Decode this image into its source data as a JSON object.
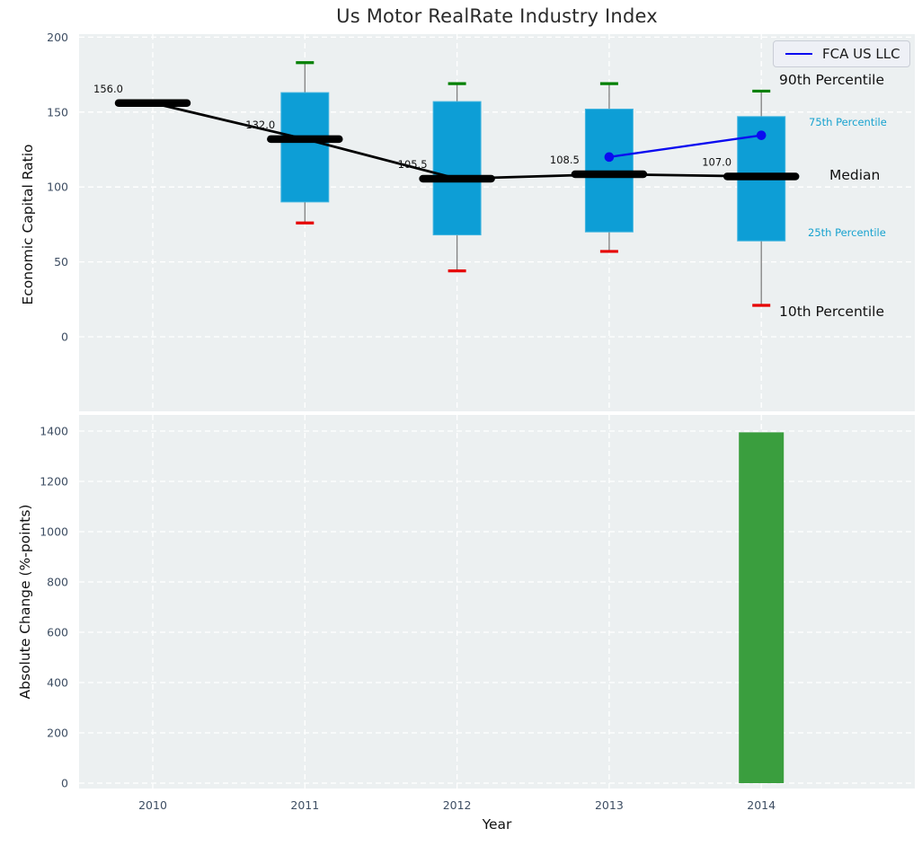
{
  "title": "Us Motor RealRate Industry Index",
  "axes": {
    "top_ylabel": "Economic Capital Ratio",
    "bottom_ylabel": "Absolute Change (%-points)",
    "xlabel": "Year"
  },
  "legend": {
    "label": "FCA US LLC"
  },
  "percentile_labels": {
    "p90": "90th Percentile",
    "p75": "75th Percentile",
    "median": "Median",
    "p25": "25th Percentile",
    "p10": "10th Percentile"
  },
  "colors": {
    "plot_bg": "#ecf0f1",
    "grid": "#ffffff",
    "tick_text": "#3e4e63",
    "box_fill": "#0d9ed6",
    "box_edge": "#45b6e0",
    "whisker_line": "#808080",
    "whisker_high_cap": "#008000",
    "whisker_low_cap": "#e60000",
    "median_line": "#000000",
    "company_line": "#0b0bf0",
    "bar_fill": "#3a9e3e",
    "median_label_text": "#111111"
  },
  "chart_data": [
    {
      "type": "boxplot",
      "title": "Us Motor RealRate Industry Index",
      "ylabel": "Economic Capital Ratio",
      "xlabel": "Year",
      "categories": [
        "2010",
        "2011",
        "2012",
        "2013",
        "2014"
      ],
      "yticks": [
        0,
        50,
        100,
        150,
        200
      ],
      "ylim": [
        -50,
        202
      ],
      "grid": true,
      "legend_position": "upper right",
      "boxes": [
        {
          "category": "2010",
          "median": 156.0,
          "median_label": "156.0",
          "q1": null,
          "q3": null,
          "p10": null,
          "p90": null
        },
        {
          "category": "2011",
          "median": 132.0,
          "median_label": "132.0",
          "q1": 90,
          "q3": 163,
          "p10": 76,
          "p90": 183
        },
        {
          "category": "2012",
          "median": 105.5,
          "median_label": "105.5",
          "q1": 68,
          "q3": 157,
          "p10": 44,
          "p90": 169
        },
        {
          "category": "2013",
          "median": 108.5,
          "median_label": "108.5",
          "q1": 70,
          "q3": 152,
          "p10": 57,
          "p90": 169
        },
        {
          "category": "2014",
          "median": 107.0,
          "median_label": "107.0",
          "q1": 64,
          "q3": 147,
          "p10": 21,
          "p90": 164
        }
      ],
      "series": [
        {
          "name": "FCA US LLC",
          "points": [
            {
              "category": "2013",
              "value": 120
            },
            {
              "category": "2014",
              "value": 134.5
            }
          ]
        }
      ]
    },
    {
      "type": "bar",
      "ylabel": "Absolute Change (%-points)",
      "xlabel": "Year",
      "categories": [
        "2010",
        "2011",
        "2012",
        "2013",
        "2014"
      ],
      "values": [
        null,
        null,
        null,
        null,
        1395
      ],
      "yticks": [
        0,
        200,
        400,
        600,
        800,
        1000,
        1200,
        1400
      ],
      "ylim": [
        0,
        1465
      ],
      "grid": true
    }
  ]
}
